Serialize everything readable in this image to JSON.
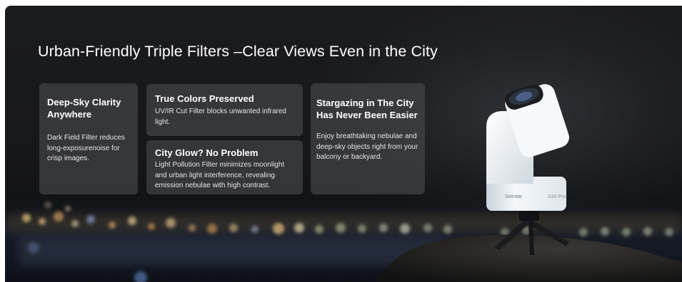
{
  "banner": {
    "title": "Urban-Friendly Triple Filters –Clear Views Even in the City"
  },
  "cards": [
    {
      "heading": "Deep-Sky Clarity Anywhere",
      "body": "Dark Field Filter reduces long-exposurenoise for crisp images."
    },
    {
      "heading": "True Colors Preserved",
      "body": "UV/IR Cut Filter blocks unwanted infrared light."
    },
    {
      "heading": "City Glow? No Problem",
      "body": "Light Pollution Filter minimizes moonlight and urban light interference, revealing emission nebulae with high contrast."
    },
    {
      "heading": "Stargazing in The City Has Never Been Easier",
      "body": "Enjoy breathtaking nebulae and deep-sky objects right from your balcony or backyard."
    }
  ],
  "product": {
    "brand_label": "Seestar",
    "model_label": "S30 Pro"
  },
  "colors": {
    "background": "#16171a",
    "card": "#484a4e",
    "text": "#ffffff",
    "telescope_body": "#eef2f5"
  }
}
